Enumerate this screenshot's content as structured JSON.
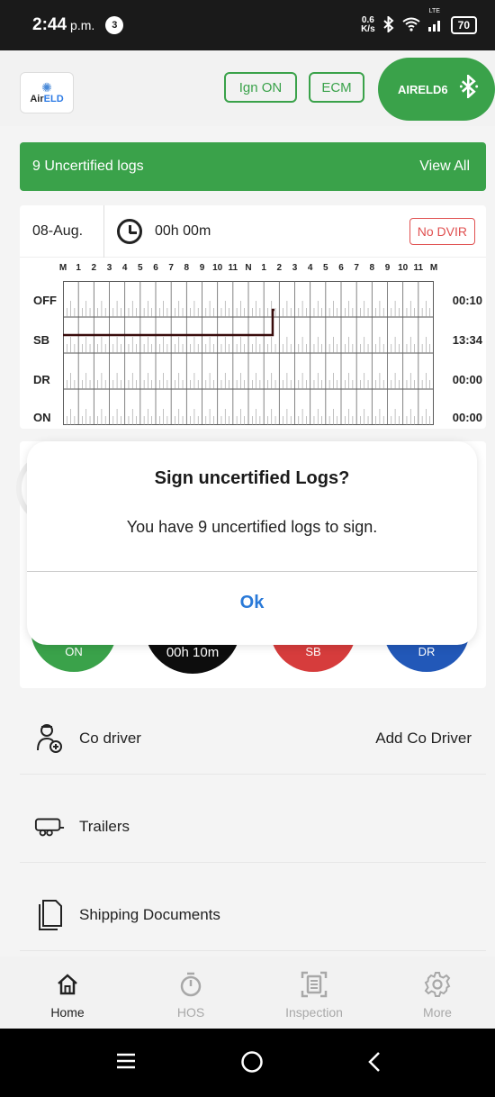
{
  "status_bar": {
    "time": "2:44",
    "ampm": "p.m.",
    "notification_count": "3",
    "net_speed_value": "0.6",
    "net_speed_unit": "K/s",
    "network": "LTE",
    "battery": "70"
  },
  "header": {
    "logo_text_air": "Air",
    "logo_text_eld": "ELD",
    "ign_label": "Ign ON",
    "ecm_label": "ECM",
    "device_label": "AIRELD6"
  },
  "banner": {
    "text": "9 Uncertified logs",
    "action": "View All"
  },
  "log": {
    "date": "08-Aug.",
    "duration": "00h 00m",
    "dvir": "No DVIR",
    "hour_labels": [
      "M",
      "1",
      "2",
      "3",
      "4",
      "5",
      "6",
      "7",
      "8",
      "9",
      "10",
      "11",
      "N",
      "1",
      "2",
      "3",
      "4",
      "5",
      "6",
      "7",
      "8",
      "9",
      "10",
      "11",
      "M"
    ],
    "rows": [
      {
        "label": "OFF",
        "total": "00:10"
      },
      {
        "label": "SB",
        "total": "13:34"
      },
      {
        "label": "DR",
        "total": "00:00"
      },
      {
        "label": "ON",
        "total": "00:00"
      }
    ]
  },
  "duty": {
    "on_label": "ON",
    "off_time": "00h 10m",
    "sb_label": "SB",
    "dr_label": "DR"
  },
  "dialog": {
    "title": "Sign uncertified Logs?",
    "message": "You have 9 uncertified logs to sign.",
    "ok": "Ok"
  },
  "list": {
    "codriver_label": "Co driver",
    "codriver_action": "Add Co Driver",
    "trailers_label": "Trailers",
    "shipping_label": "Shipping Documents"
  },
  "nav": {
    "home": "Home",
    "hos": "HOS",
    "inspection": "Inspection",
    "more": "More"
  },
  "colors": {
    "green": "#3aa24a",
    "red_status": "#e05050",
    "dialog_button": "#2979d8"
  }
}
